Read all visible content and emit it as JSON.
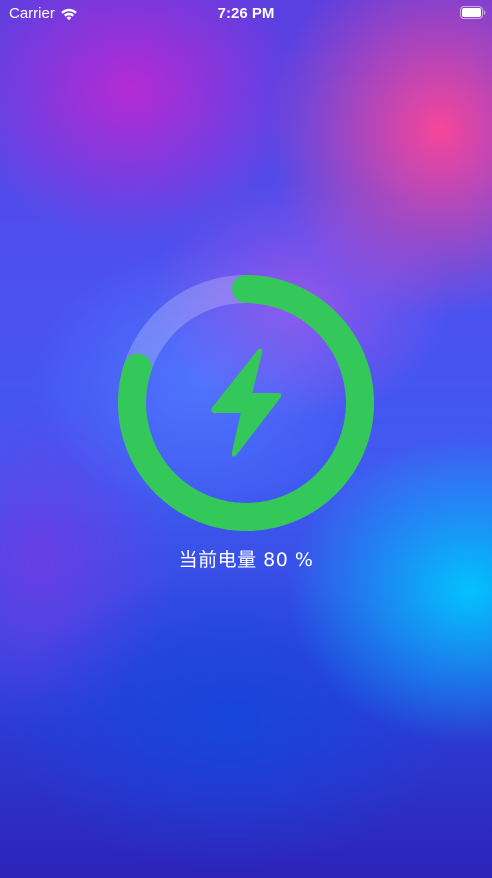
{
  "status_bar": {
    "carrier": "Carrier",
    "time": "7:26 PM",
    "icons": [
      "wifi-icon",
      "battery-icon"
    ]
  },
  "charging": {
    "label": "当前电量 80 %",
    "progress": 0.8,
    "icon": "lightning-bolt-icon"
  },
  "colors": {
    "ring_progress": "#34c759",
    "ring_track": "rgba(255,255,255,0.22)",
    "bolt": "#34c759",
    "text": "#ffffff"
  }
}
